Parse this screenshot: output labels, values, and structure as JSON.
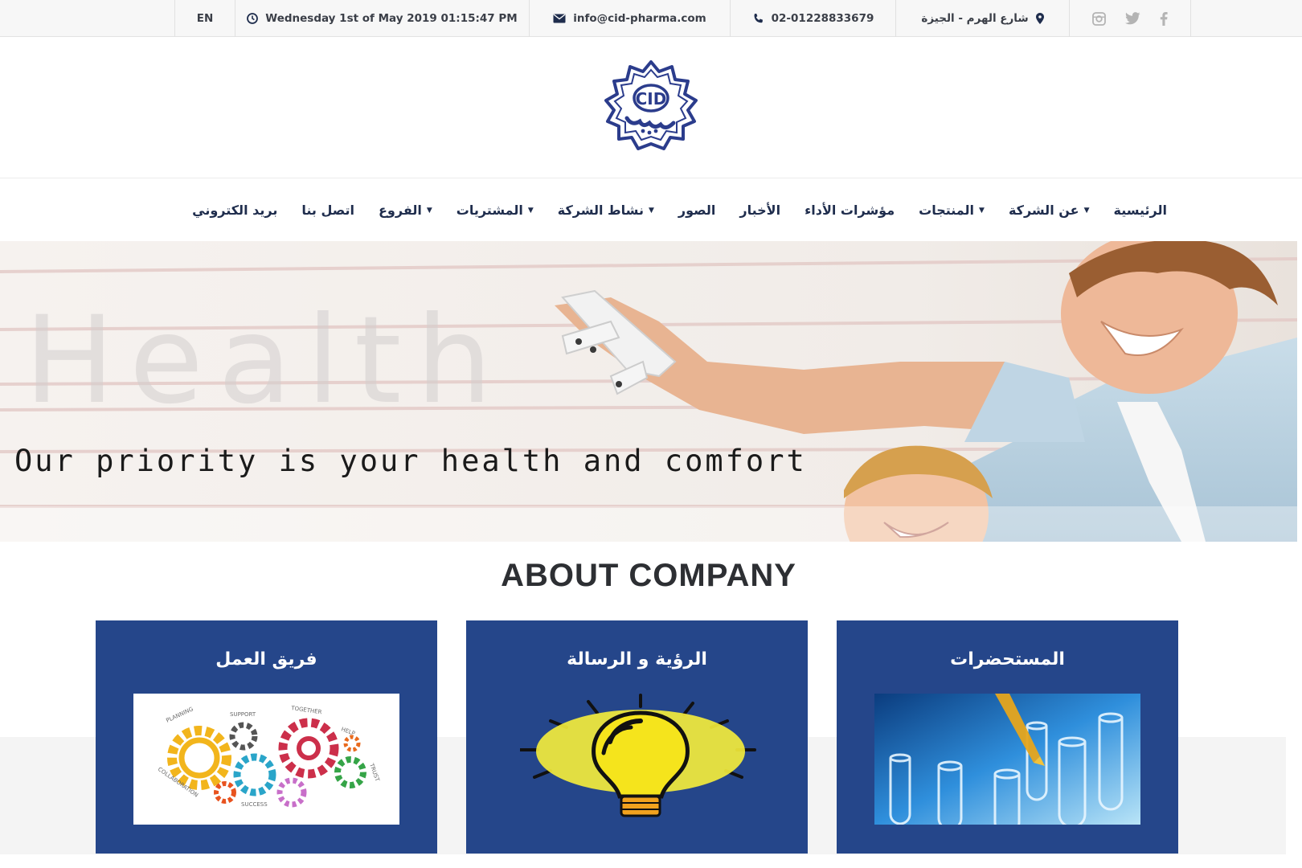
{
  "topbar": {
    "language": "EN",
    "datetime": "Wednesday 1st of May 2019 01:15:47 PM",
    "email": "info@cid-pharma.com",
    "phone": "02-01228833679",
    "address": "شارع الهرم - الجيزة",
    "social_icons": [
      "instagram-icon",
      "twitter-icon",
      "facebook-icon"
    ]
  },
  "logo": {
    "text": "CID"
  },
  "nav": {
    "items": [
      {
        "label": "الرئيسية",
        "dropdown": false
      },
      {
        "label": "عن الشركة",
        "dropdown": true
      },
      {
        "label": "المنتجات",
        "dropdown": true
      },
      {
        "label": "مؤشرات الأداء",
        "dropdown": false
      },
      {
        "label": "الأخبار",
        "dropdown": false
      },
      {
        "label": "الصور",
        "dropdown": false
      },
      {
        "label": "نشاط الشركة",
        "dropdown": true
      },
      {
        "label": "المشتريات",
        "dropdown": true
      },
      {
        "label": "الفروع",
        "dropdown": true
      },
      {
        "label": "اتصل بنا",
        "dropdown": false
      },
      {
        "label": "بريد الكتروني",
        "dropdown": false
      }
    ]
  },
  "banner": {
    "caption": "Our priority is your health and comfort",
    "watermark": "Health"
  },
  "about": {
    "title": "ABOUT COMPANY",
    "cards": [
      {
        "title": "المستحضرات",
        "image": "test-tubes-image"
      },
      {
        "title": "الرؤية و الرسالة",
        "image": "light-bulb-image"
      },
      {
        "title": "فريق العمل",
        "image": "teamwork-gears-image",
        "image_words": [
          "PLANNING",
          "SUPPORT",
          "TOGETHER",
          "HELP",
          "TRUST",
          "COLLABORATION",
          "SUCCESS"
        ]
      }
    ]
  },
  "colors": {
    "navy": "#25468a",
    "nav_text": "#1f2d4d",
    "topbar_bg": "#f7f7f7"
  }
}
